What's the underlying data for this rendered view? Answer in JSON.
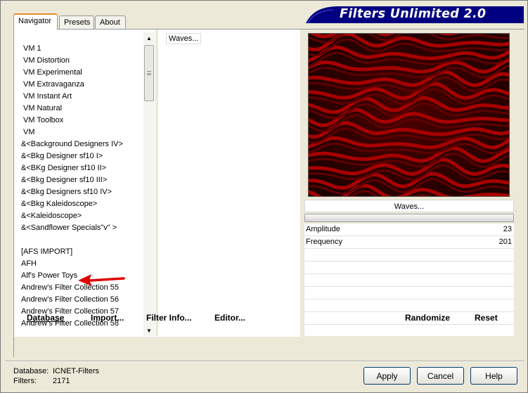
{
  "title": "Filters Unlimited 2.0",
  "tabs": [
    "Navigator",
    "Presets",
    "About"
  ],
  "categories": [
    "VM 1",
    "VM Distortion",
    "VM Experimental",
    "VM Extravaganza",
    "VM Instant Art",
    "VM Natural",
    "VM Toolbox",
    "VM",
    "&<Background Designers IV>",
    "&<Bkg Designer sf10 I>",
    "&<BKg Designer sf10 II>",
    "&<Bkg Designer sf10 III>",
    "&<Bkg Designers sf10 IV>",
    "&<Bkg Kaleidoscope>",
    "&<Kaleidoscope>",
    "&<Sandflower Specials\"v\" >",
    "",
    "[AFS IMPORT]",
    "AFH",
    "Alf's Power Toys",
    "Andrew's Filter Collection 55",
    "Andrew's Filter Collection 56",
    "Andrew's Filter Collection 57",
    "Andrew's Filter Collection 58"
  ],
  "filters": [
    "Waves..."
  ],
  "preview_label": "Waves...",
  "params": [
    {
      "name": "Amplitude",
      "value": "23"
    },
    {
      "name": "Frequency",
      "value": "201"
    }
  ],
  "left_buttons": {
    "database": "Database",
    "import": "Import...",
    "filter_info": "Filter Info...",
    "editor": "Editor..."
  },
  "right_buttons": {
    "randomize": "Randomize",
    "reset": "Reset"
  },
  "status": {
    "database_label": "Database:",
    "database_value": "ICNET-Filters",
    "filters_label": "Filters:",
    "filters_value": "2171"
  },
  "dialog_buttons": {
    "apply": "Apply",
    "cancel": "Cancel",
    "help": "Help"
  },
  "colors": {
    "banner": "#000080",
    "preview_dark": "#3a0000",
    "preview_red": "#9e0000",
    "arrow": "#e00000"
  }
}
